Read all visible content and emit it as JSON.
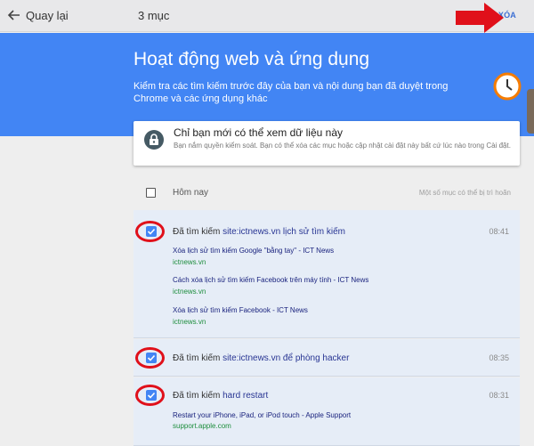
{
  "topbar": {
    "back_label": "Quay lại",
    "count": "3 mục",
    "delete_label": "XÓA"
  },
  "banner": {
    "title": "Hoạt động web và ứng dụng",
    "description": "Kiểm tra các tìm kiếm trước đây của bạn và nội dung bạn đã duyệt trong Chrome và các ứng dụng khác"
  },
  "private_card": {
    "title": "Chỉ bạn mới có thể xem dữ liệu này",
    "description": "Bạn nắm quyền kiểm soát. Bạn có thể xóa các mục hoặc cập nhật cài đặt này bất cứ lúc nào trong Cài đặt."
  },
  "day_group": {
    "label": "Hôm nay",
    "note": "Một số mục có thể bị trì hoãn"
  },
  "items": [
    {
      "prefix": "Đã tìm kiếm",
      "query": "site:ictnews.vn lịch sử tìm kiếm",
      "time": "08:41",
      "links": [
        {
          "title": "Xóa lịch sử tìm kiếm Google \"bằng tay\" - ICT News",
          "domain": "ictnews.vn"
        },
        {
          "title": "Cách xóa lịch sử tìm kiếm Facebook trên máy tính - ICT News",
          "domain": "ictnews.vn"
        },
        {
          "title": "Xóa lịch sử tìm kiếm Facebook - ICT News",
          "domain": "ictnews.vn"
        }
      ]
    },
    {
      "prefix": "Đã tìm kiếm",
      "query": "site:ictnews.vn để phòng hacker",
      "time": "08:35",
      "links": []
    },
    {
      "prefix": "Đã tìm kiếm",
      "query": "hard restart",
      "time": "08:31",
      "links": [
        {
          "title": "Restart your iPhone, iPad, or iPod touch - Apple Support",
          "domain": "support.apple.com"
        }
      ]
    }
  ],
  "colors": {
    "accent": "#4285f4",
    "annotation": "#e0101a",
    "link": "#1a237e",
    "domain": "#1e8e3e"
  }
}
